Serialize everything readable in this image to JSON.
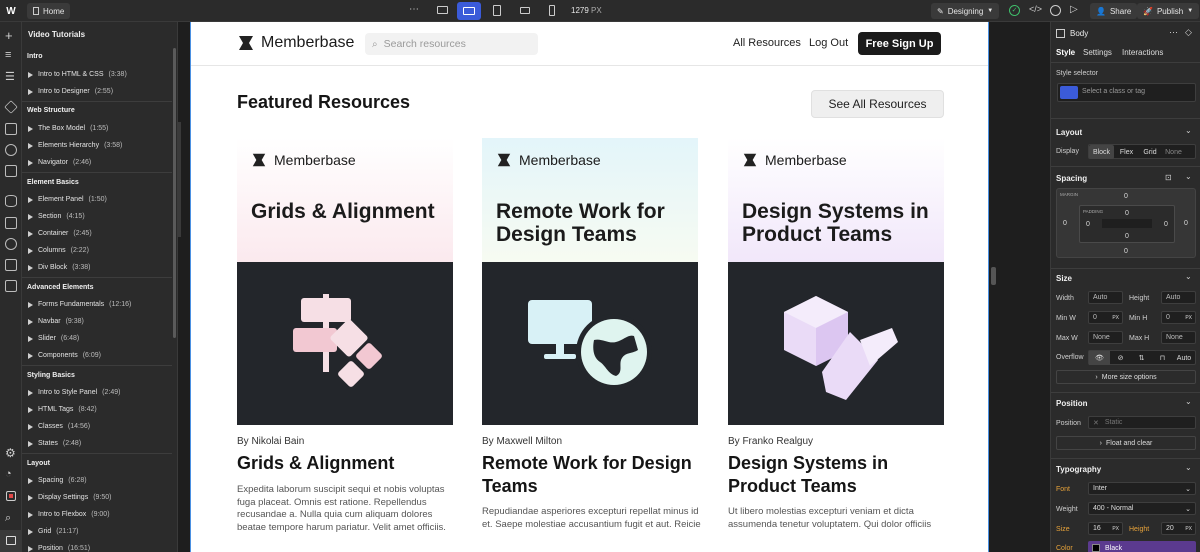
{
  "topbar": {
    "home_label": "Home",
    "width_value": "1279",
    "width_unit": "PX",
    "mode_label": "Designing",
    "share_label": "Share",
    "publish_label": "Publish"
  },
  "navigator": {
    "title": "Video Tutorials",
    "sections": [
      {
        "label": "Intro",
        "items": [
          {
            "label": "Intro to HTML & CSS",
            "dur": "(3:38)"
          },
          {
            "label": "Intro to Designer",
            "dur": "(2:55)"
          }
        ]
      },
      {
        "label": "Web Structure",
        "items": [
          {
            "label": "The Box Model",
            "dur": "(1:55)"
          },
          {
            "label": "Elements Hierarchy",
            "dur": "(3:58)"
          },
          {
            "label": "Navigator",
            "dur": "(2:46)"
          }
        ]
      },
      {
        "label": "Element Basics",
        "items": [
          {
            "label": "Element Panel",
            "dur": "(1:50)"
          },
          {
            "label": "Section",
            "dur": "(4:15)"
          },
          {
            "label": "Container",
            "dur": "(2:45)"
          },
          {
            "label": "Columns",
            "dur": "(2:22)"
          },
          {
            "label": "Div Block",
            "dur": "(3:38)"
          }
        ]
      },
      {
        "label": "Advanced Elements",
        "items": [
          {
            "label": "Forms Fundamentals",
            "dur": "(12:16)"
          },
          {
            "label": "Navbar",
            "dur": "(9:38)"
          },
          {
            "label": "Slider",
            "dur": "(6:48)"
          },
          {
            "label": "Components",
            "dur": "(6:09)"
          }
        ]
      },
      {
        "label": "Styling Basics",
        "items": [
          {
            "label": "Intro to Style Panel",
            "dur": "(2:49)"
          },
          {
            "label": "HTML Tags",
            "dur": "(8:42)"
          },
          {
            "label": "Classes",
            "dur": "(14:56)"
          },
          {
            "label": "States",
            "dur": "(2:48)"
          }
        ]
      },
      {
        "label": "Layout",
        "items": [
          {
            "label": "Spacing",
            "dur": "(6:28)"
          },
          {
            "label": "Display Settings",
            "dur": "(9:50)"
          },
          {
            "label": "Intro to Flexbox",
            "dur": "(9:00)"
          },
          {
            "label": "Grid",
            "dur": "(21:17)"
          },
          {
            "label": "Position",
            "dur": "(16:51)"
          }
        ]
      }
    ]
  },
  "site": {
    "brand": "Memberbase",
    "search_placeholder": "Search resources",
    "nav": {
      "all": "All Resources",
      "logout": "Log Out",
      "signup": "Free Sign Up"
    },
    "heading": "Featured Resources",
    "see_all": "See All Resources",
    "cards": [
      {
        "image_title": "Grids & Alignment",
        "author": "By Nikolai Bain",
        "title": "Grids & Alignment",
        "excerpt": "Expedita laborum suscipit sequi et nobis voluptas fuga placeat. Omnis est ratione. Repellendus recusandae a. Nulla quia cum aliquam dolores beatae tempore harum pariatur. Velit amet officiis."
      },
      {
        "image_title": "Remote Work for Design Teams",
        "author": "By Maxwell Milton",
        "title": "Remote Work for Design Teams",
        "excerpt": "Repudiandae asperiores excepturi repellat minus id et. Saepe molestiae accusantium fugit et aut. Reicie"
      },
      {
        "image_title": "Design Systems in Product Teams",
        "author": "By Franko Realguy",
        "title": "Design Systems in Product Teams",
        "excerpt": "Ut libero molestias excepturi veniam et dicta assumenda tenetur voluptatem. Qui dolor officiis"
      }
    ]
  },
  "style_panel": {
    "element": "Body",
    "tabs": [
      "Style",
      "Settings",
      "Interactions"
    ],
    "selector_label": "Style selector",
    "selector_placeholder": "Select a class or tag",
    "layout": {
      "label": "Layout",
      "display_label": "Display",
      "options": [
        "Block",
        "Flex",
        "Grid",
        "None"
      ]
    },
    "spacing": {
      "label": "Spacing",
      "margin_label": "MARGIN",
      "padding_label": "PADDING",
      "zero": "0"
    },
    "size": {
      "label": "Size",
      "width": "Width",
      "height": "Height",
      "auto": "Auto",
      "minw": "Min W",
      "minh": "Min H",
      "maxw": "Max W",
      "maxh": "Max H",
      "none": "None",
      "zero": "0",
      "px": "PX",
      "overflow": "Overflow",
      "overflow_auto": "Auto",
      "more": "More size options"
    },
    "position": {
      "label": "Position",
      "field": "Position",
      "value": "Static",
      "float": "Float and clear"
    },
    "typography": {
      "label": "Typography",
      "font_label": "Font",
      "font_value": "Inter",
      "weight_label": "Weight",
      "weight_value": "400 - Normal",
      "size_label": "Size",
      "size_value": "16",
      "height_label": "Height",
      "height_value": "20",
      "px": "PX",
      "color_label": "Color",
      "color_value": "Black"
    }
  }
}
